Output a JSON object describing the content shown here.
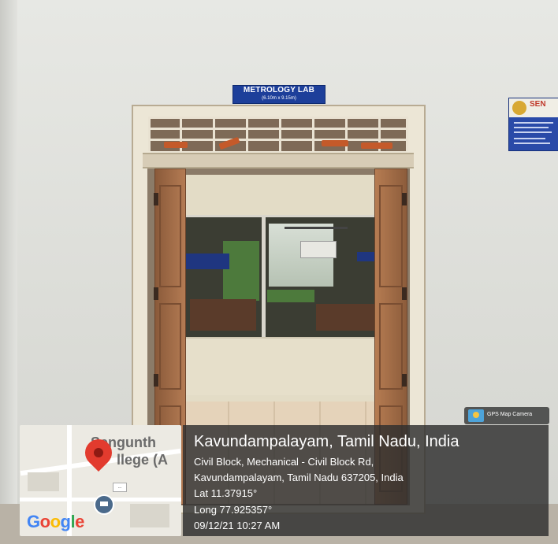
{
  "photo": {
    "lab_sign": {
      "title": "METROLOGY LAB",
      "subtitle": "(6.10m x 9.15m)"
    },
    "side_sign": {
      "heading": "SEN"
    }
  },
  "gps_overlay": {
    "app_badge": "GPS Map Camera",
    "map": {
      "place_label_1": "Sengunth",
      "place_label_2": "llege (A",
      "brand": "Google",
      "chip": "..."
    },
    "location_title": "Kavundampalayam, Tamil Nadu, India",
    "address_line_1": "Civil Block, Mechanical - Civil Block Rd,",
    "address_line_2": "Kavundampalayam, Tamil Nadu 637205, India",
    "latitude": "Lat 11.37915°",
    "longitude": "Long 77.925357°",
    "datetime": "09/12/21 10:27 AM"
  },
  "colors": {
    "google_blue": "#4285F4",
    "google_red": "#EA4335",
    "google_yellow": "#FBBC05",
    "google_green": "#34A853",
    "overlay_bg": "#2e2e2e"
  }
}
